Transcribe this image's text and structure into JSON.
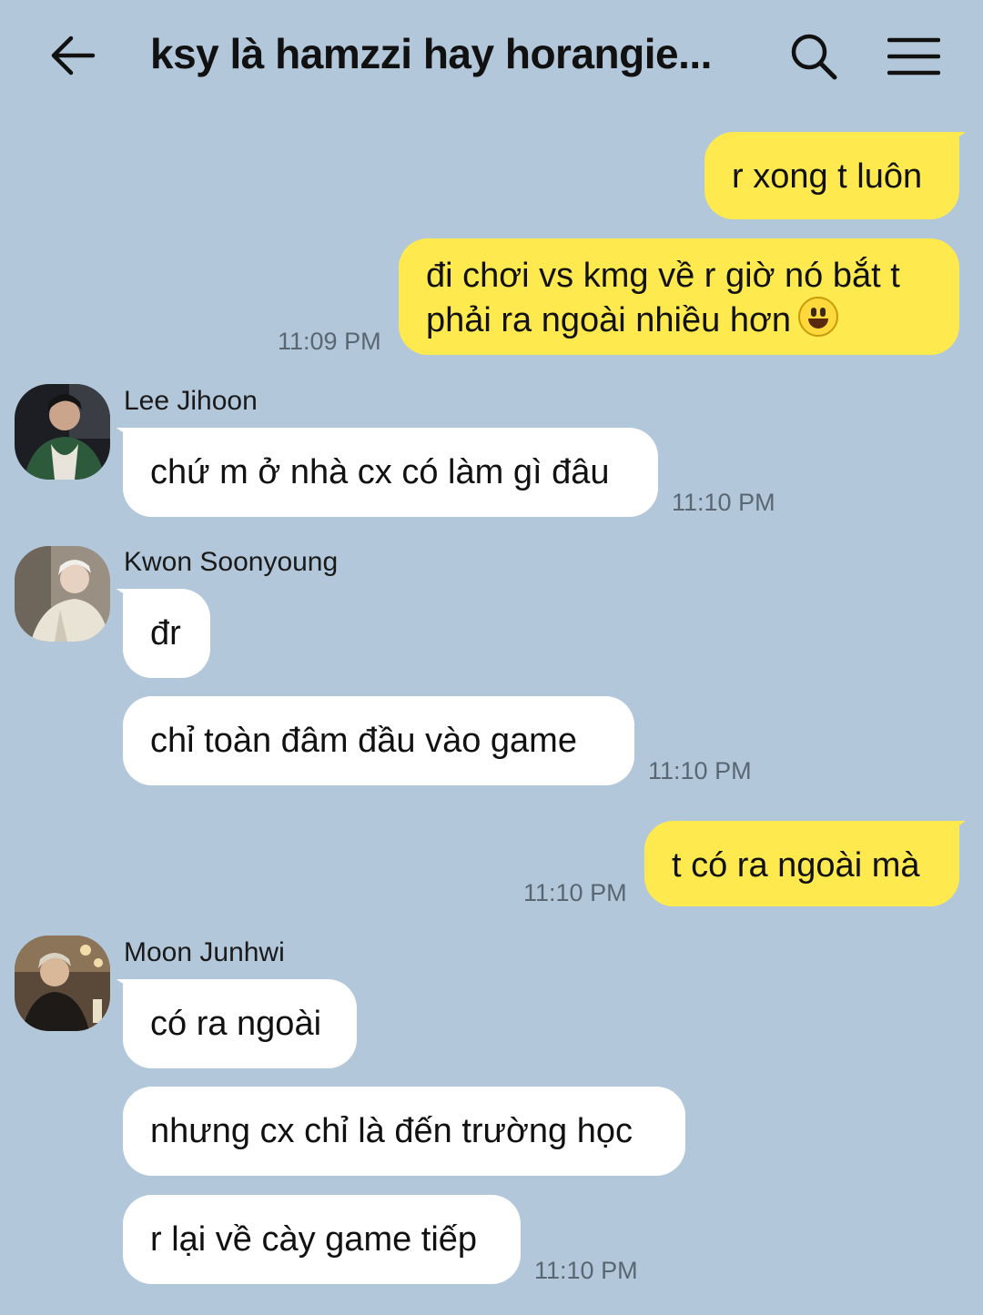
{
  "header": {
    "title": "ksy là hamzzi hay horangie...",
    "back_icon": "arrow-left-icon",
    "search_icon": "search-icon",
    "menu_icon": "hamburger-menu-icon"
  },
  "colors": {
    "background": "#b2c7d9",
    "my_bubble": "#fee94e",
    "their_bubble": "#ffffff"
  },
  "messages": [
    {
      "sender": "me",
      "text": "r xong t luôn"
    },
    {
      "sender": "me",
      "line1": "đi chơi vs kmg về r giờ nó bắt t",
      "line2": "phải ra ngoài nhiều hơn",
      "emoji": "grinning-face-emoji",
      "time": "11:09 PM"
    },
    {
      "sender": "Lee Jihoon",
      "text": "chứ m ở nhà cx có làm gì đâu",
      "time": "11:10 PM"
    },
    {
      "sender": "Kwon Soonyoung",
      "text": "đr"
    },
    {
      "sender": "Kwon Soonyoung",
      "text": "chỉ toàn đâm đầu vào game",
      "time": "11:10 PM"
    },
    {
      "sender": "me",
      "text": "t có ra ngoài mà",
      "time": "11:10 PM"
    },
    {
      "sender": "Moon Junhwi",
      "text": "có ra ngoài"
    },
    {
      "sender": "Moon Junhwi",
      "text": "nhưng cx chỉ là đến trường học"
    },
    {
      "sender": "Moon Junhwi",
      "text": "r lại về cày game tiếp",
      "time": "11:10 PM"
    }
  ]
}
